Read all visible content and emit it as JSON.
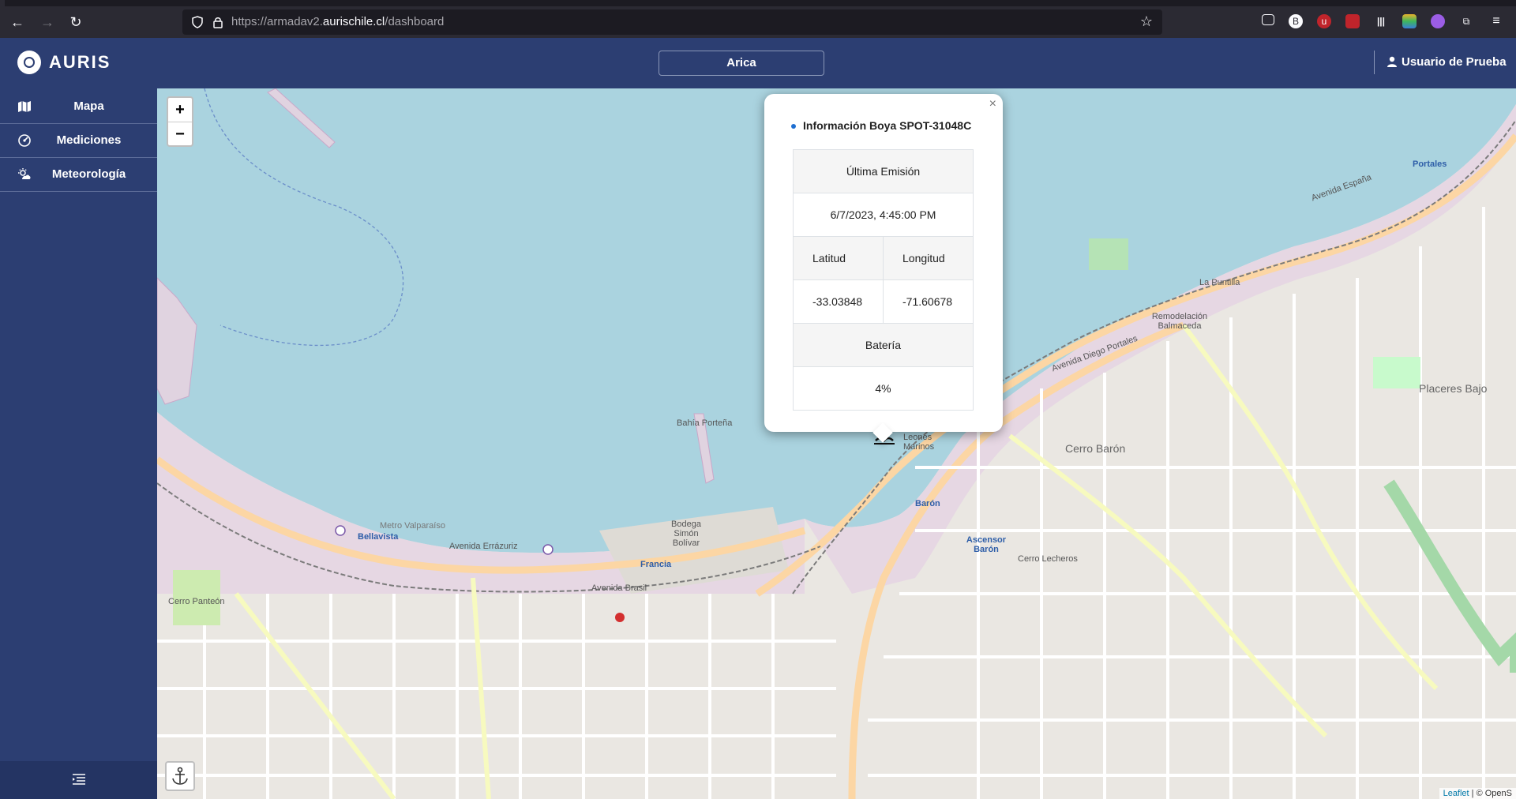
{
  "browser": {
    "url_prefix": "https://armadav2.",
    "url_domain": "aurischile.cl",
    "url_path": "/dashboard"
  },
  "app": {
    "brand": "AURIS",
    "location_button": "Arica",
    "user_name": "Usuario de Prueba"
  },
  "sidebar": {
    "items": [
      {
        "label": "Mapa",
        "icon": "map-icon"
      },
      {
        "label": "Mediciones",
        "icon": "gauge-icon"
      },
      {
        "label": "Meteorología",
        "icon": "weather-icon"
      }
    ]
  },
  "map": {
    "zoom_in": "+",
    "zoom_out": "−",
    "attribution_leaflet": "Leaflet",
    "attribution_rest": "| © OpenS",
    "labels": {
      "cerro_baron": "Cerro Barón",
      "placeres_bajo": "Placeres Bajo",
      "la_punilla": "La Puntilla",
      "remodelacion": "Remodelación Balmaceda",
      "cerro_lecheros": "Cerro Lecheros",
      "cerro_panteon": "Cerro Panteón",
      "bellavista": "Bellavista",
      "francia": "Francia",
      "baron": "Barón",
      "portales": "Portales",
      "ascensor_baron": "Ascensor Barón",
      "bahia_portena": "Bahía Porteña",
      "bodega": "Bodega Simón Bolívar",
      "mirador": "Mirador Leones Marinos",
      "avenida_errazuriz": "Avenida Errázuriz",
      "avenida_espana": "Avenida España",
      "avenida_brasil": "Avenida Brasil",
      "metro": "Metro Valparaíso",
      "avenida_diego_portales": "Avenida Diego Portales"
    }
  },
  "popup": {
    "title": "Información Boya SPOT-31048C",
    "close": "×",
    "last_emission_label": "Última Emisión",
    "last_emission_value": "6/7/2023, 4:45:00 PM",
    "lat_label": "Latitud",
    "lon_label": "Longitud",
    "lat_value": "-33.03848",
    "lon_value": "-71.60678",
    "battery_label": "Batería",
    "battery_value": "4%"
  }
}
